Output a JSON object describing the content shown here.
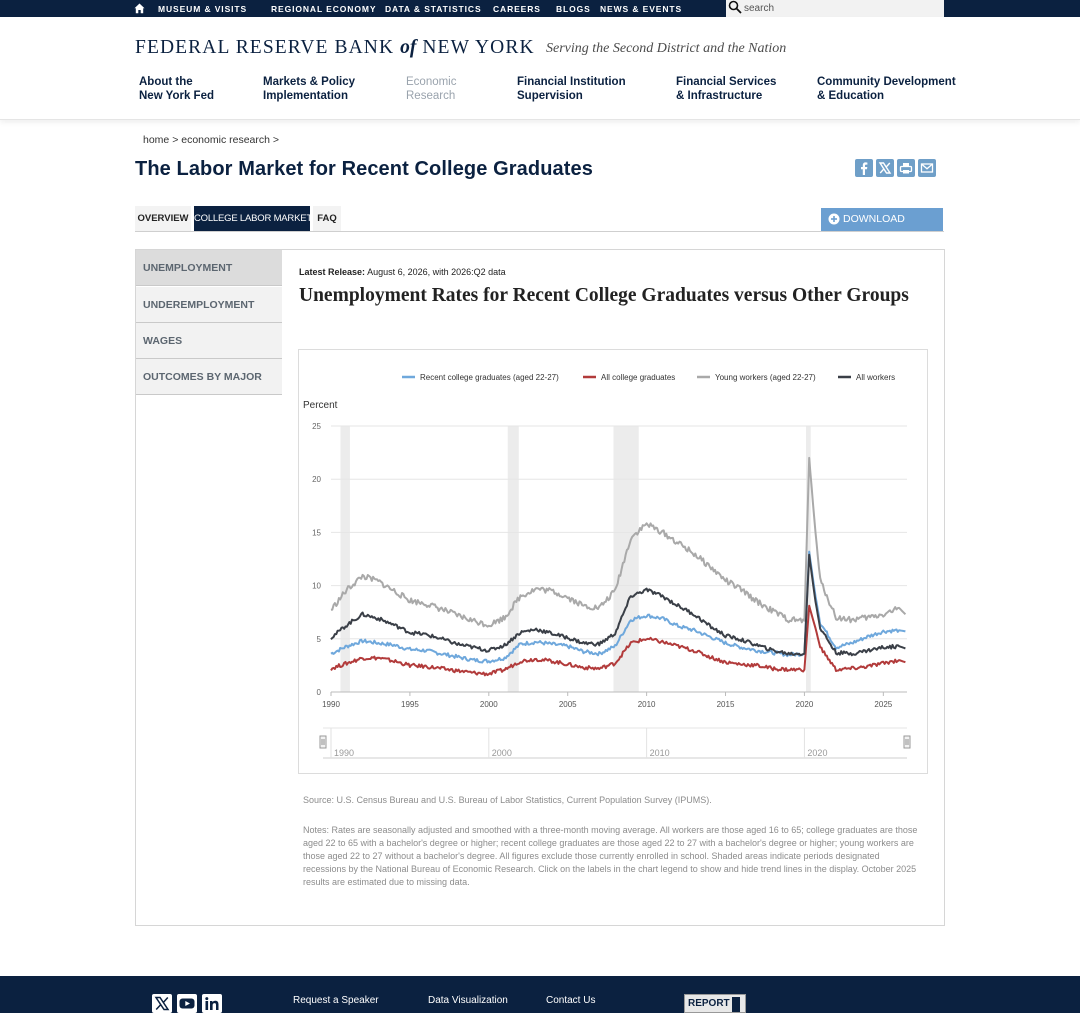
{
  "topnav": {
    "items": [
      "MUSEUM & VISITS",
      "REGIONAL ECONOMY",
      "DATA & STATISTICS",
      "CAREERS",
      "BLOGS",
      "NEWS & EVENTS"
    ],
    "search_placeholder": "search"
  },
  "header": {
    "brand_pre": "FEDERAL RESERVE BANK",
    "brand_of": "of",
    "brand_post": "NEW YORK",
    "tagline": "Serving the Second District and the Nation",
    "nav": [
      {
        "line1": "About the",
        "line2": "New York Fed"
      },
      {
        "line1": "Markets & Policy",
        "line2": "Implementation"
      },
      {
        "line1": "Economic",
        "line2": "Research"
      },
      {
        "line1": "Financial Institution",
        "line2": "Supervision"
      },
      {
        "line1": "Financial Services",
        "line2": "& Infrastructure"
      },
      {
        "line1": "Community Development",
        "line2": "& Education"
      }
    ]
  },
  "breadcrumb": {
    "home": "home",
    "sep": ">",
    "section": "economic research"
  },
  "page": {
    "title": "The Labor Market for Recent College Graduates"
  },
  "tabs": [
    "OVERVIEW",
    "COLLEGE LABOR MARKET",
    "FAQ"
  ],
  "download_label": "DOWNLOAD",
  "sidebar": [
    "UNEMPLOYMENT",
    "UNDEREMPLOYMENT",
    "WAGES",
    "OUTCOMES BY MAJOR"
  ],
  "content": {
    "release_label": "Latest Release:",
    "release_text": "August 6, 2026, with 2026:Q2 data",
    "chart_title": "Unemployment Rates for Recent College Graduates versus Other Groups",
    "source": "Source: U.S. Census Bureau and U.S. Bureau of Labor Statistics, Current Population Survey (IPUMS).",
    "notes": "Notes: Rates are seasonally adjusted and smoothed with a three-month moving average. All workers are those aged 16 to 65; college graduates are those aged 22 to 65 with a bachelor's degree or higher; recent college graduates are those aged 22 to 27 with a bachelor's degree or higher; young workers are those aged 22 to 27 without a bachelor's degree. All figures exclude those currently enrolled in school. Shaded areas indicate periods designated recessions by the National Bureau of Economic Research. Click on the labels in the chart legend to show and hide trend lines in the display. October 2025 results are estimated due to missing data."
  },
  "chart_data": {
    "type": "line",
    "ylabel": "Percent",
    "ylim": [
      0,
      25
    ],
    "xlim": [
      1990,
      2026.5
    ],
    "yticks": [
      0,
      5,
      10,
      15,
      20,
      25
    ],
    "xticks": [
      1990,
      1995,
      2000,
      2005,
      2010,
      2015,
      2020,
      2025
    ],
    "navigator_ticks": [
      1990,
      2000,
      2010,
      2020
    ],
    "grid": true,
    "legend": "top",
    "recessions": [
      [
        1990.6,
        1991.2
      ],
      [
        2001.2,
        2001.9
      ],
      [
        2007.9,
        2009.5
      ],
      [
        2020.1,
        2020.4
      ]
    ],
    "series": [
      {
        "name": "Recent college graduates (aged 22-27)",
        "color": "#6fa8dc",
        "points": [
          [
            1990,
            3.6
          ],
          [
            1991,
            4.3
          ],
          [
            1992,
            4.8
          ],
          [
            1993,
            4.6
          ],
          [
            1994,
            4.4
          ],
          [
            1995,
            4.0
          ],
          [
            1996,
            3.9
          ],
          [
            1997,
            3.6
          ],
          [
            1998,
            3.3
          ],
          [
            1999,
            3.0
          ],
          [
            2000,
            2.9
          ],
          [
            2001,
            3.2
          ],
          [
            2002,
            4.5
          ],
          [
            2003,
            4.7
          ],
          [
            2004,
            4.5
          ],
          [
            2005,
            4.3
          ],
          [
            2006,
            3.8
          ],
          [
            2007,
            3.6
          ],
          [
            2008,
            4.3
          ],
          [
            2009,
            6.8
          ],
          [
            2010,
            7.2
          ],
          [
            2011,
            6.9
          ],
          [
            2012,
            6.2
          ],
          [
            2013,
            5.8
          ],
          [
            2014,
            5.2
          ],
          [
            2015,
            4.6
          ],
          [
            2016,
            4.2
          ],
          [
            2017,
            3.9
          ],
          [
            2018,
            3.7
          ],
          [
            2019,
            3.5
          ],
          [
            2020,
            3.6
          ],
          [
            2020.3,
            13.2
          ],
          [
            2020.7,
            9.0
          ],
          [
            2021,
            6.5
          ],
          [
            2022,
            4.2
          ],
          [
            2023,
            4.6
          ],
          [
            2024,
            5.2
          ],
          [
            2025,
            5.7
          ],
          [
            2026,
            5.8
          ],
          [
            2026.4,
            5.7
          ]
        ]
      },
      {
        "name": "All college graduates",
        "color": "#b23b3b",
        "points": [
          [
            1990,
            2.2
          ],
          [
            1991,
            2.7
          ],
          [
            1992,
            3.2
          ],
          [
            1993,
            3.2
          ],
          [
            1994,
            2.9
          ],
          [
            1995,
            2.5
          ],
          [
            1996,
            2.4
          ],
          [
            1997,
            2.2
          ],
          [
            1998,
            2.0
          ],
          [
            1999,
            1.8
          ],
          [
            2000,
            1.7
          ],
          [
            2001,
            2.1
          ],
          [
            2002,
            2.9
          ],
          [
            2003,
            3.1
          ],
          [
            2004,
            2.9
          ],
          [
            2005,
            2.6
          ],
          [
            2006,
            2.3
          ],
          [
            2007,
            2.2
          ],
          [
            2008,
            2.7
          ],
          [
            2009,
            4.6
          ],
          [
            2010,
            5.0
          ],
          [
            2011,
            4.7
          ],
          [
            2012,
            4.3
          ],
          [
            2013,
            3.9
          ],
          [
            2014,
            3.3
          ],
          [
            2015,
            2.8
          ],
          [
            2016,
            2.6
          ],
          [
            2017,
            2.5
          ],
          [
            2018,
            2.2
          ],
          [
            2019,
            2.1
          ],
          [
            2020,
            2.1
          ],
          [
            2020.3,
            8.1
          ],
          [
            2020.7,
            6.0
          ],
          [
            2021,
            4.2
          ],
          [
            2022,
            2.1
          ],
          [
            2023,
            2.2
          ],
          [
            2024,
            2.4
          ],
          [
            2025,
            2.7
          ],
          [
            2026,
            3.0
          ],
          [
            2026.4,
            2.8
          ]
        ]
      },
      {
        "name": "Young workers (aged 22-27)",
        "color": "#a9a9a9",
        "points": [
          [
            1990,
            7.7
          ],
          [
            1991,
            9.6
          ],
          [
            1992,
            10.9
          ],
          [
            1993,
            10.4
          ],
          [
            1994,
            9.5
          ],
          [
            1995,
            8.6
          ],
          [
            1996,
            8.3
          ],
          [
            1997,
            7.8
          ],
          [
            1998,
            7.2
          ],
          [
            1999,
            6.7
          ],
          [
            2000,
            6.3
          ],
          [
            2001,
            7.0
          ],
          [
            2002,
            9.0
          ],
          [
            2003,
            9.7
          ],
          [
            2004,
            9.5
          ],
          [
            2005,
            8.9
          ],
          [
            2006,
            8.1
          ],
          [
            2007,
            7.9
          ],
          [
            2008,
            9.5
          ],
          [
            2009,
            14.5
          ],
          [
            2010,
            15.8
          ],
          [
            2011,
            15.0
          ],
          [
            2012,
            14.0
          ],
          [
            2013,
            13.0
          ],
          [
            2014,
            11.8
          ],
          [
            2015,
            10.5
          ],
          [
            2016,
            9.6
          ],
          [
            2017,
            8.5
          ],
          [
            2018,
            7.6
          ],
          [
            2019,
            6.8
          ],
          [
            2020,
            6.7
          ],
          [
            2020.3,
            22.0
          ],
          [
            2020.7,
            15.0
          ],
          [
            2021,
            10.5
          ],
          [
            2022,
            7.0
          ],
          [
            2023,
            6.8
          ],
          [
            2024,
            7.0
          ],
          [
            2025,
            7.3
          ],
          [
            2026,
            7.9
          ],
          [
            2026.4,
            7.3
          ]
        ]
      },
      {
        "name": "All workers",
        "color": "#3a3f47",
        "points": [
          [
            1990,
            5.1
          ],
          [
            1991,
            6.3
          ],
          [
            1992,
            7.3
          ],
          [
            1993,
            6.9
          ],
          [
            1994,
            6.3
          ],
          [
            1995,
            5.6
          ],
          [
            1996,
            5.4
          ],
          [
            1997,
            5.0
          ],
          [
            1998,
            4.5
          ],
          [
            1999,
            4.2
          ],
          [
            2000,
            3.9
          ],
          [
            2001,
            4.4
          ],
          [
            2002,
            5.6
          ],
          [
            2003,
            5.9
          ],
          [
            2004,
            5.5
          ],
          [
            2005,
            5.1
          ],
          [
            2006,
            4.6
          ],
          [
            2007,
            4.5
          ],
          [
            2008,
            5.5
          ],
          [
            2009,
            9.0
          ],
          [
            2010,
            9.6
          ],
          [
            2011,
            9.0
          ],
          [
            2012,
            8.1
          ],
          [
            2013,
            7.3
          ],
          [
            2014,
            6.2
          ],
          [
            2015,
            5.3
          ],
          [
            2016,
            4.9
          ],
          [
            2017,
            4.4
          ],
          [
            2018,
            3.9
          ],
          [
            2019,
            3.6
          ],
          [
            2020,
            3.6
          ],
          [
            2020.3,
            12.9
          ],
          [
            2020.7,
            8.5
          ],
          [
            2021,
            6.0
          ],
          [
            2022,
            3.7
          ],
          [
            2023,
            3.6
          ],
          [
            2024,
            3.9
          ],
          [
            2025,
            4.2
          ],
          [
            2026,
            4.3
          ],
          [
            2026.4,
            4.1
          ]
        ]
      }
    ]
  },
  "footer": {
    "links": [
      "Request a Speaker",
      "Data Visualization",
      "Contact Us"
    ],
    "report_label": "REPORT"
  },
  "colors": {
    "navy": "#0b2140",
    "accent_blue": "#6b9fd1",
    "share_blue": "#6f9fc8"
  }
}
